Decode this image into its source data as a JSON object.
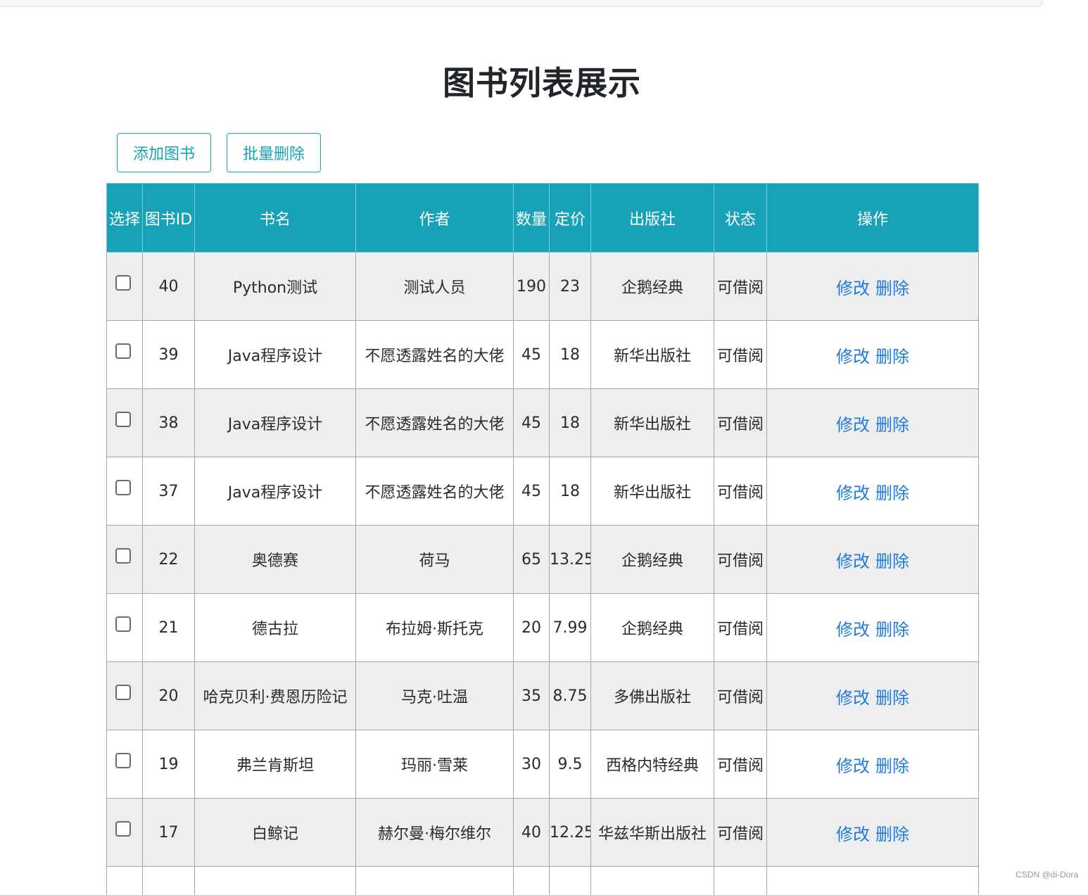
{
  "page": {
    "title": "图书列表展示"
  },
  "toolbar": {
    "add_label": "添加图书",
    "batch_delete_label": "批量删除"
  },
  "table": {
    "columns": [
      "选择",
      "图书ID",
      "书名",
      "作者",
      "数量",
      "定价",
      "出版社",
      "状态",
      "操作"
    ],
    "rows": [
      {
        "id": "40",
        "name": "Python测试",
        "author": "测试人员",
        "count": "190",
        "price": "23",
        "publisher": "企鹅经典",
        "status": "可借阅"
      },
      {
        "id": "39",
        "name": "Java程序设计",
        "author": "不愿透露姓名的大佬",
        "count": "45",
        "price": "18",
        "publisher": "新华出版社",
        "status": "可借阅"
      },
      {
        "id": "38",
        "name": "Java程序设计",
        "author": "不愿透露姓名的大佬",
        "count": "45",
        "price": "18",
        "publisher": "新华出版社",
        "status": "可借阅"
      },
      {
        "id": "37",
        "name": "Java程序设计",
        "author": "不愿透露姓名的大佬",
        "count": "45",
        "price": "18",
        "publisher": "新华出版社",
        "status": "可借阅"
      },
      {
        "id": "22",
        "name": "奥德赛",
        "author": "荷马",
        "count": "65",
        "price": "13.25",
        "publisher": "企鹅经典",
        "status": "可借阅"
      },
      {
        "id": "21",
        "name": "德古拉",
        "author": "布拉姆·斯托克",
        "count": "20",
        "price": "7.99",
        "publisher": "企鹅经典",
        "status": "可借阅"
      },
      {
        "id": "20",
        "name": "哈克贝利·费恩历险记",
        "author": "马克·吐温",
        "count": "35",
        "price": "8.75",
        "publisher": "多佛出版社",
        "status": "可借阅"
      },
      {
        "id": "19",
        "name": "弗兰肯斯坦",
        "author": "玛丽·雪莱",
        "count": "30",
        "price": "9.5",
        "publisher": "西格内特经典",
        "status": "可借阅"
      },
      {
        "id": "17",
        "name": "白鲸记",
        "author": "赫尔曼·梅尔维尔",
        "count": "40",
        "price": "12.25",
        "publisher": "华兹华斯出版社",
        "status": "可借阅"
      }
    ],
    "edit_label": "修改",
    "delete_label": "删除"
  },
  "watermark": "CSDN @di-Dora",
  "colors": {
    "header_bg": "#17a2b8",
    "link": "#1e7be0",
    "stripe": "#eeeeee"
  }
}
